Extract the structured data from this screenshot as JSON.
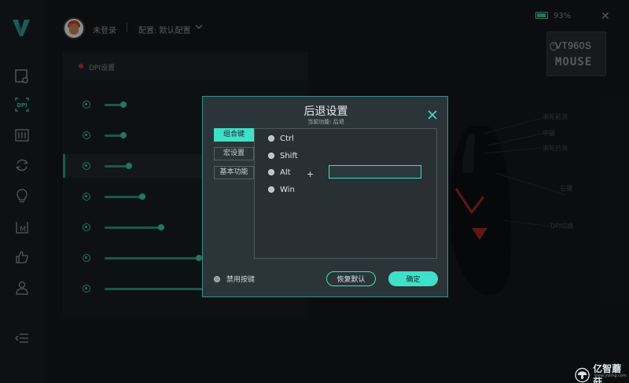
{
  "header": {
    "login_status": "未登录",
    "config_label": "配置: 默认配置",
    "battery_percent": "93%",
    "battery_level": 0.93
  },
  "device": {
    "model": "VT960S",
    "type": "MOUSE"
  },
  "dpi_panel": {
    "title": "DPI设置",
    "levels": [
      0.1,
      0.1,
      0.13,
      0.2,
      0.3,
      0.5,
      0.75
    ],
    "active_index": 2
  },
  "mouse_callouts": [
    "滚轮前滚",
    "中键",
    "滚轮后滚",
    "右键",
    "DPI切换"
  ],
  "dialog": {
    "title": "后退设置",
    "subtitle": "当前功能: 后退",
    "tabs": [
      {
        "label": "组合键"
      },
      {
        "label": "宏设置"
      },
      {
        "label": "基本功能"
      }
    ],
    "modifiers": [
      "Ctrl",
      "Shift",
      "Alt",
      "Win"
    ],
    "plus_sign": "+",
    "key_value": "",
    "disable_label": "禁用按键",
    "reset_button": "恢复默认",
    "ok_button": "确定"
  },
  "watermark": {
    "brand": "亿智蘑菇",
    "url": "www.yizmg.com"
  },
  "colors": {
    "accent": "#3fe0c8",
    "background": "#15191d",
    "dialog_bg": "#2b3438"
  }
}
